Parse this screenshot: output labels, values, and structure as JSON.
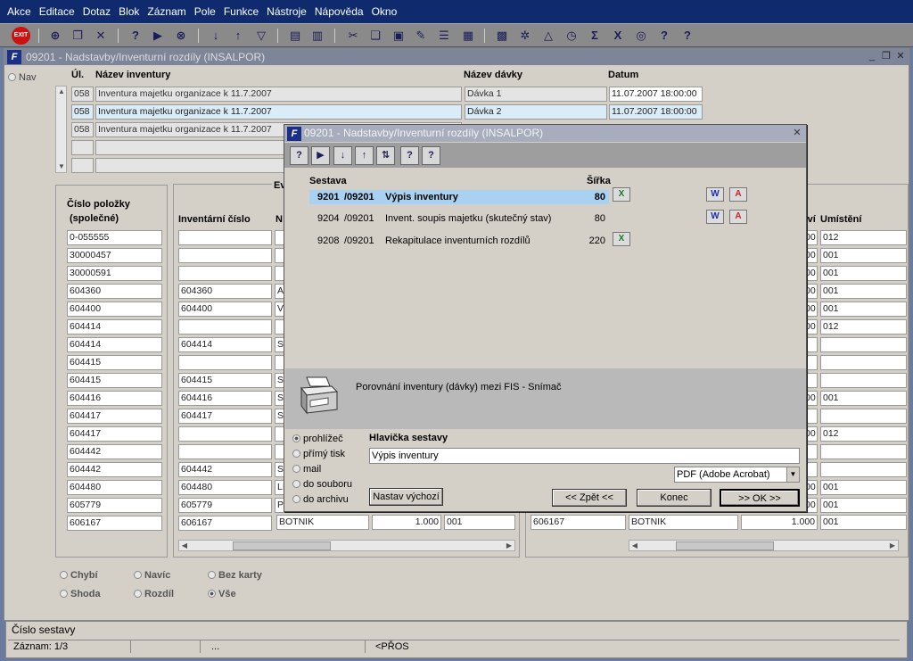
{
  "menu": [
    "Akce",
    "Editace",
    "Dotaz",
    "Blok",
    "Záznam",
    "Pole",
    "Funkce",
    "Nástroje",
    "Nápověda",
    "Okno"
  ],
  "toolbar": {
    "exit_label": "EXIT"
  },
  "window": {
    "title": "09201 - Nadstavby/Inventurní rozdíly (INSALPOR)",
    "nav_label": "Nav"
  },
  "top_table": {
    "headers": {
      "ul": "Úl.",
      "name": "Název inventury",
      "batch": "Název dávky",
      "date": "Datum"
    },
    "rows": [
      {
        "ul": "058",
        "name": "Inventura majetku organizace k 11.7.2007",
        "batch": "Dávka 1",
        "date": "11.07.2007 18:00:00"
      },
      {
        "ul": "058",
        "name": "Inventura majetku organizace k 11.7.2007",
        "batch": "Dávka 2",
        "date": "11.07.2007 18:00:00"
      },
      {
        "ul": "058",
        "name": "Inventura majetku organizace k 11.7.2007",
        "batch": "",
        "date": ""
      }
    ]
  },
  "left_col": {
    "header1": "Číslo položky",
    "header2": "(společné)",
    "items": [
      "0-055555",
      "30000457",
      "30000591",
      "604360",
      "604400",
      "604414",
      "604414",
      "604415",
      "604415",
      "604416",
      "604417",
      "604417",
      "604442",
      "604442",
      "604480",
      "605779",
      "606167"
    ]
  },
  "mid_col": {
    "group_label": "Ev",
    "header_inv": "Inventární číslo",
    "header_name": "N",
    "inv": [
      "",
      "",
      "",
      "604360",
      "604400",
      "",
      "604414",
      "",
      "604415",
      "604416",
      "604417",
      "",
      "",
      "604442",
      "604480",
      "605779",
      "606167"
    ],
    "name_prefix": [
      "",
      "",
      "",
      "A",
      "V",
      "",
      "S",
      "",
      "S",
      "S",
      "S",
      "",
      "",
      "S",
      "LI",
      "P",
      ""
    ],
    "last_name": "BOTNIK",
    "last_qty": "1.000",
    "last_loc": "001"
  },
  "right_col": {
    "header_suffix": "tví",
    "header_loc": "Umístění",
    "prefix": [
      "00",
      "00",
      "00",
      "00",
      "00",
      "00",
      "",
      "",
      "",
      "00",
      "",
      "00",
      "",
      "",
      "00",
      "00",
      ""
    ],
    "loc": [
      "012",
      "001",
      "001",
      "001",
      "001",
      "012",
      "",
      "",
      "",
      "001",
      "",
      "012",
      "",
      "",
      "001",
      "001",
      ""
    ],
    "last_inv": "606167",
    "last_name": "BOTNIK",
    "last_qty": "1.000",
    "last_loc": "001"
  },
  "filters": {
    "r1": [
      "Chybí",
      "Navíc",
      "Bez karty"
    ],
    "r2": [
      "Shoda",
      "Rozdíl",
      "Vše"
    ]
  },
  "status": {
    "line1": "Číslo sestavy",
    "record": "Záznam: 1/3",
    "dots": "...",
    "mode": "<PŘOS"
  },
  "dialog": {
    "title": "09201 - Nadstavby/Inventurní rozdíly (INSALPOR)",
    "col_report": "Sestava",
    "col_width": "Šířka",
    "rows": [
      {
        "code": "9201",
        "sub": "/09201",
        "name": "Výpis inventury",
        "width": "80"
      },
      {
        "code": "9204",
        "sub": "/09201",
        "name": "Invent. soupis majetku (skutečný stav)",
        "width": "80"
      },
      {
        "code": "9208",
        "sub": "/09201",
        "name": "Rekapitulace inventurních rozdílů",
        "width": "220"
      }
    ],
    "description": "Porovnání inventury (dávky) mezi FIS - Snímač",
    "outputs": [
      "prohlížeč",
      "přímý tisk",
      "mail",
      "do souboru",
      "do archivu"
    ],
    "header_label": "Hlavička sestavy",
    "header_value": "Výpis inventury",
    "format": "PDF (Adobe Acrobat)",
    "btn_default": "Nastav výchozí",
    "btn_back": "<< Zpět <<",
    "btn_end": "Konec",
    "btn_ok": ">> OK >>",
    "icons": {
      "excel": "X",
      "word": "W",
      "pdf": "A"
    }
  }
}
